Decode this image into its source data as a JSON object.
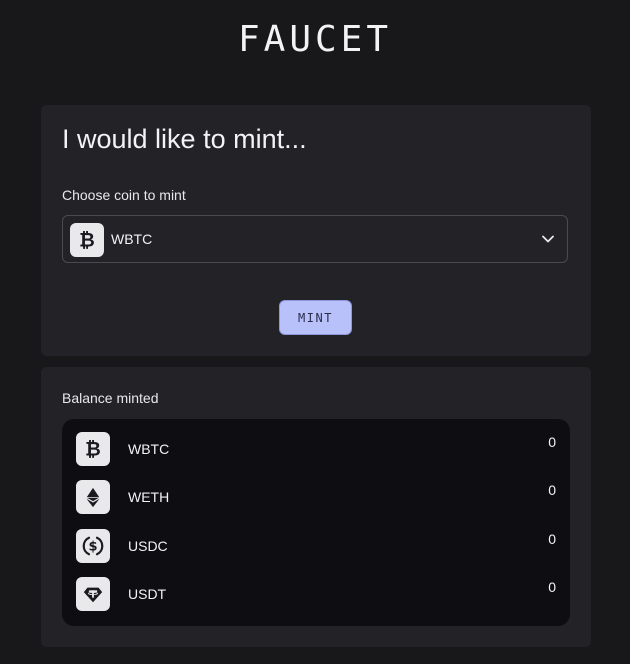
{
  "header": {
    "logo_text": "FAUCET"
  },
  "mint_panel": {
    "title": "I would like to mint...",
    "choose_label": "Choose coin to mint",
    "selected_coin": "WBTC",
    "selected_icon": "bitcoin-icon",
    "mint_button_label": "MINT"
  },
  "balance_panel": {
    "label": "Balance minted",
    "rows": [
      {
        "name": "WBTC",
        "amount": "0",
        "icon": "bitcoin-icon"
      },
      {
        "name": "WETH",
        "amount": "0",
        "icon": "ethereum-icon"
      },
      {
        "name": "USDC",
        "amount": "0",
        "icon": "usdc-icon"
      },
      {
        "name": "USDT",
        "amount": "0",
        "icon": "tether-icon"
      }
    ]
  },
  "colors": {
    "background": "#18181a",
    "card": "#232327",
    "list_background": "#0e0e12",
    "button": "#b9c1fa",
    "icon_tile": "#e9e9ec"
  }
}
